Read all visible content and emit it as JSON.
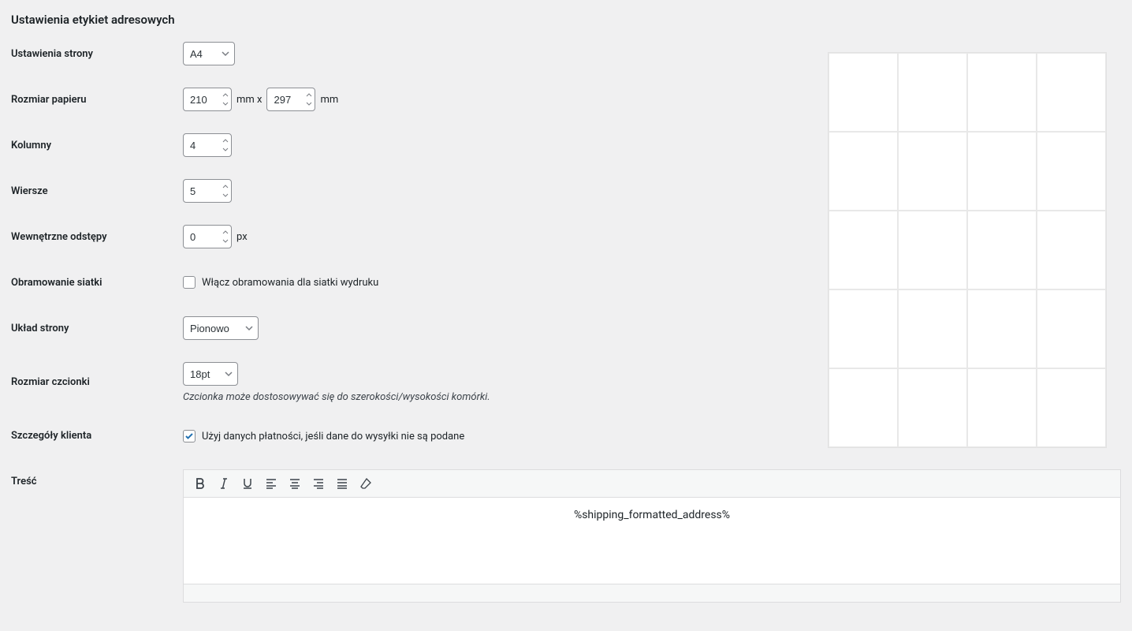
{
  "title": "Ustawienia etykiet adresowych",
  "labels": {
    "page_settings": "Ustawienia strony",
    "paper_size": "Rozmiar papieru",
    "columns": "Kolumny",
    "rows": "Wiersze",
    "inner_padding": "Wewnętrzne odstępy",
    "grid_border": "Obramowanie siatki",
    "page_layout": "Układ strony",
    "font_size": "Rozmiar czcionki",
    "customer_details": "Szczegóły klienta",
    "content": "Treść"
  },
  "values": {
    "page_settings": "A4",
    "paper_width": "210",
    "paper_height": "297",
    "columns": "4",
    "rows": "5",
    "padding": "0",
    "page_layout": "Pionowo",
    "font_size": "18pt"
  },
  "units": {
    "mm": "mm",
    "mm_x": "mm x",
    "px": "px"
  },
  "checkbox": {
    "grid_border_label": "Włącz obramowania dla siatki wydruku",
    "grid_border_checked": false,
    "customer_details_label": "Użyj danych płatności, jeśli dane do wysyłki nie są podane",
    "customer_details_checked": true
  },
  "desc": {
    "font_size": "Czcionka może dostosowywać się do szerokości/wysokości komórki."
  },
  "editor": {
    "content": "%shipping_formatted_address%"
  },
  "preview": {
    "cols": 4,
    "rows": 5
  }
}
